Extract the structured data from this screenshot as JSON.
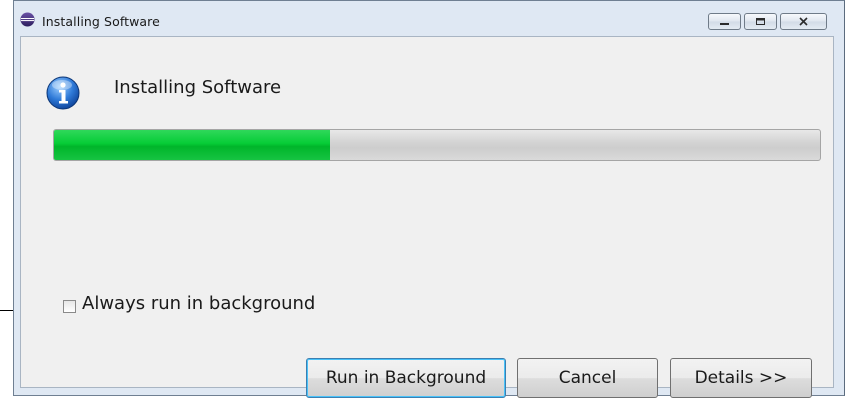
{
  "window": {
    "title": "Installing Software",
    "icon": "eclipse-icon",
    "controls": {
      "minimize": "minimize-icon",
      "maximize": "maximize-icon",
      "close": "close-icon"
    }
  },
  "header": {
    "icon": "info-icon",
    "title": "Installing Software"
  },
  "progress": {
    "fraction": 0.36,
    "color": "#00c832"
  },
  "options": {
    "always_background_label": "Always run in background",
    "always_background_checked": false
  },
  "buttons": {
    "run_in_background": "Run in Background",
    "cancel": "Cancel",
    "details": "Details >>"
  }
}
